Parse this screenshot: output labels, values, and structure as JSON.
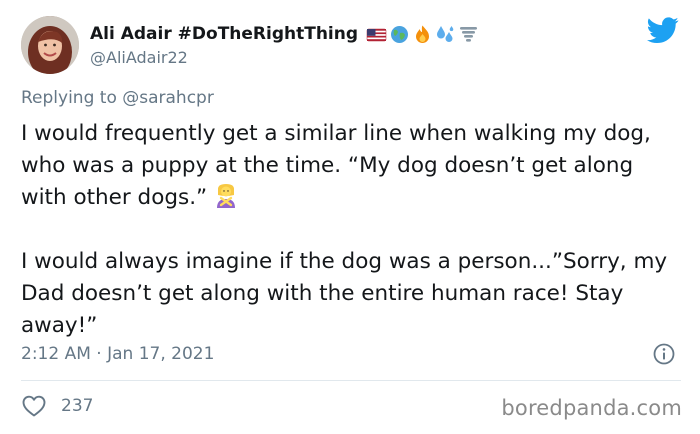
{
  "author": {
    "display_name": "Ali Adair #DoTheRightThing",
    "handle": "@AliAdair22",
    "badges": [
      "us-flag-icon",
      "globe-icon",
      "fire-icon",
      "sweat-droplets-icon",
      "tornado-icon"
    ]
  },
  "reply": {
    "prefix": "Replying to",
    "mention": "@sarahcpr"
  },
  "tweet": {
    "paragraph_1": "I would frequently get a similar line when walking my dog, who was a puppy at the time. “My dog doesn’t get along with other dogs.”",
    "paragraph_1_emoji": "person-gesturing-no-icon",
    "paragraph_2": "I would always imagine if the dog was a person...”Sorry, my Dad doesn’t get along with the entire human race! Stay away!”"
  },
  "meta": {
    "timestamp": "2:12 AM · Jan 17, 2021"
  },
  "stats": {
    "likes": "237"
  },
  "watermark": "boredpanda.com",
  "colors": {
    "twitter_blue": "#1da1f2",
    "secondary_text": "#657786",
    "primary_text": "#14171a",
    "divider": "#e1e8ed"
  }
}
